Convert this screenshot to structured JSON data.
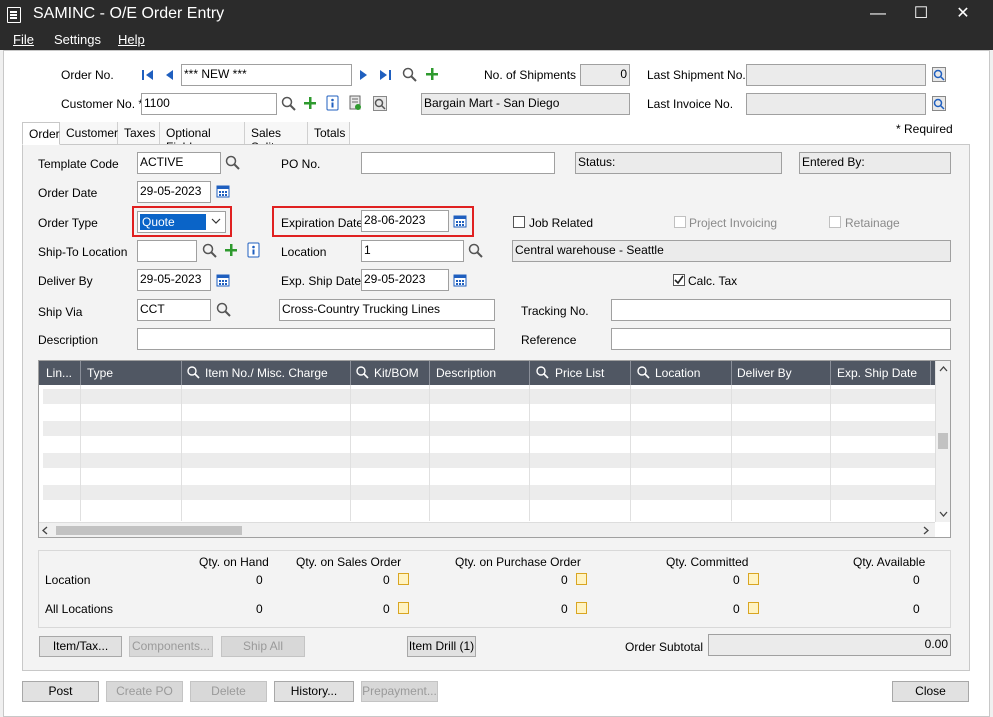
{
  "window": {
    "title": "SAMINC - O/E Order Entry",
    "minimize": "—",
    "maximize": "☐",
    "close": "✕"
  },
  "menu": {
    "file": "File",
    "settings": "Settings",
    "help": "Help"
  },
  "header": {
    "order_no_label": "Order No.",
    "order_no_value": "*** NEW ***",
    "customer_no_label": "Customer No. *",
    "customer_no_value": "1100",
    "customer_name": "Bargain Mart - San Diego",
    "shipments_label": "No. of Shipments",
    "shipments_value": "0",
    "last_shipment_label": "Last Shipment No.",
    "last_shipment_value": "",
    "last_invoice_label": "Last Invoice No.",
    "last_invoice_value": ""
  },
  "tabs": [
    {
      "label": "Order"
    },
    {
      "label": "Customer"
    },
    {
      "label": "Taxes"
    },
    {
      "label": "Optional Fields"
    },
    {
      "label": "Sales Split"
    },
    {
      "label": "Totals"
    }
  ],
  "required_note": "*   Required",
  "order": {
    "template_label": "Template Code",
    "template_value": "ACTIVE",
    "po_label": "PO No.",
    "po_value": "",
    "status_label": "Status:",
    "entered_by_label": "Entered By:",
    "order_date_label": "Order Date",
    "order_date_value": "29-05-2023",
    "order_type_label": "Order Type",
    "order_type_value": "Quote",
    "expiration_label": "Expiration Date",
    "expiration_value": "28-06-2023",
    "job_related_label": "Job Related",
    "project_invoicing_label": "Project Invoicing",
    "retainage_label": "Retainage",
    "ship_to_label": "Ship-To Location",
    "ship_to_value": "",
    "location_label": "Location",
    "location_value": "1",
    "location_desc": "Central warehouse - Seattle",
    "deliver_by_label": "Deliver By",
    "deliver_by_value": "29-05-2023",
    "exp_ship_label": "Exp. Ship Date",
    "exp_ship_value": "29-05-2023",
    "calc_tax_label": "Calc. Tax",
    "ship_via_label": "Ship Via",
    "ship_via_value": "CCT",
    "ship_via_desc": "Cross-Country Trucking Lines",
    "tracking_label": "Tracking No.",
    "tracking_value": "",
    "description_label": "Description",
    "description_value": "",
    "reference_label": "Reference",
    "reference_value": ""
  },
  "grid": {
    "columns": [
      "Lin...",
      "Type",
      "Item No./ Misc. Charge",
      "Kit/BOM",
      "Description",
      "Price List",
      "Location",
      "Deliver By",
      "Exp. Ship Date"
    ]
  },
  "stock": {
    "headers": [
      "Qty. on Hand",
      "Qty. on Sales Order",
      "Qty. on Purchase Order",
      "Qty. Committed",
      "Qty. Available"
    ],
    "rows": [
      {
        "label": "Location",
        "values": [
          "0",
          "0",
          "0",
          "0",
          "0"
        ]
      },
      {
        "label": "All Locations",
        "values": [
          "0",
          "0",
          "0",
          "0",
          "0"
        ]
      }
    ]
  },
  "buttons": {
    "item_tax": "Item/Tax...",
    "components": "Components...",
    "ship_all": "Ship All",
    "item_drill": "Item Drill (1)",
    "order_subtotal_label": "Order Subtotal",
    "order_subtotal_value": "0.00",
    "post": "Post",
    "create_po": "Create PO",
    "delete": "Delete",
    "history": "History...",
    "prepayment": "Prepayment...",
    "close": "Close"
  },
  "colors": {
    "accent_green": "#2e9a2e",
    "accent_blue": "#1f5fbf",
    "highlight_red": "#e02020",
    "grid_header": "#505763"
  }
}
